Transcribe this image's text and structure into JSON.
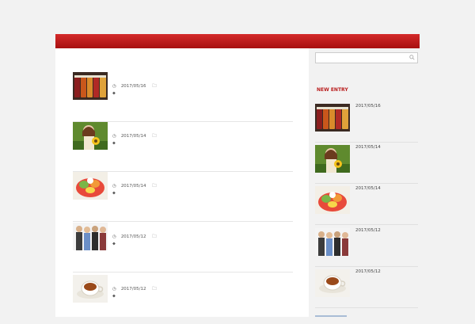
{
  "site": {
    "title": ""
  },
  "nav": {
    "home_label": ""
  },
  "posts": [
    {
      "title": "",
      "date": "2017/05/16",
      "category": "",
      "tag": "",
      "excerpt": ""
    },
    {
      "title": "",
      "date": "2017/05/14",
      "category": "",
      "tag": "",
      "excerpt": ""
    },
    {
      "title": "",
      "date": "2017/05/14",
      "category": "",
      "tag": "",
      "excerpt": ""
    },
    {
      "title": "",
      "date": "2017/05/12",
      "category": "",
      "tag": "",
      "excerpt": ""
    },
    {
      "title": "",
      "date": "2017/05/12",
      "category": "",
      "tag": "",
      "excerpt": ""
    }
  ],
  "sidebar": {
    "search_placeholder": "",
    "category_link": "",
    "new_entry_heading": "NEW ENTRY",
    "entries": [
      {
        "date": "2017/05/16",
        "title": ""
      },
      {
        "date": "2017/05/14",
        "title": ""
      },
      {
        "date": "2017/05/14",
        "title": ""
      },
      {
        "date": "2017/05/12",
        "title": ""
      },
      {
        "date": "2017/05/12",
        "title": ""
      }
    ]
  },
  "icons": {
    "clock": "clock-icon",
    "folder": "folder-icon",
    "tag": "tag-icon",
    "search": "search-icon"
  },
  "colors": {
    "nav_red": "#c21818",
    "accent_red": "#b91c1c",
    "link_blue": "#2a6db5"
  }
}
